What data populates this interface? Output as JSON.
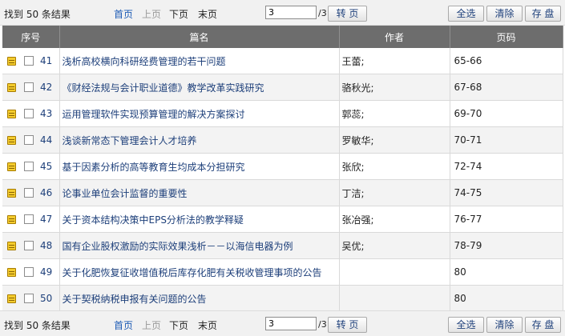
{
  "toolbar": {
    "found_text": "找到 50 条结果",
    "first": "首页",
    "prev": "上页",
    "next": "下页",
    "last": "末页",
    "page_value": "3",
    "total_pages": "/3",
    "go": "转 页",
    "select_all": "全选",
    "clear": "清除",
    "save": "存 盘"
  },
  "headers": {
    "index": "序号",
    "title": "篇名",
    "author": "作者",
    "pages": "页码"
  },
  "rows": [
    {
      "no": "41",
      "title": "浅析高校横向科研经费管理的若干问题",
      "author": "王蕾;",
      "pages": "65-66"
    },
    {
      "no": "42",
      "title": "《财经法规与会计职业道德》教学改革实践研究",
      "author": "骆秋光;",
      "pages": "67-68"
    },
    {
      "no": "43",
      "title": "运用管理软件实现预算管理的解决方案探讨",
      "author": "郭蕊;",
      "pages": "69-70"
    },
    {
      "no": "44",
      "title": "浅谈新常态下管理会计人才培养",
      "author": "罗敏华;",
      "pages": "70-71"
    },
    {
      "no": "45",
      "title": "基于因素分析的高等教育生均成本分担研究",
      "author": "张欣;",
      "pages": "72-74"
    },
    {
      "no": "46",
      "title": "论事业单位会计监督的重要性",
      "author": "丁洁;",
      "pages": "74-75"
    },
    {
      "no": "47",
      "title": "关于资本结构决策中EPS分析法的教学释疑",
      "author": "张冶强;",
      "pages": "76-77"
    },
    {
      "no": "48",
      "title": "国有企业股权激励的实际效果浅析－－以海信电器为例",
      "author": "吴优;",
      "pages": "78-79"
    },
    {
      "no": "49",
      "title": "关于化肥恢复征收增值税后库存化肥有关税收管理事项的公告",
      "author": "",
      "pages": "80"
    },
    {
      "no": "50",
      "title": "关于契税纳税申报有关问题的公告",
      "author": "",
      "pages": "80"
    }
  ]
}
